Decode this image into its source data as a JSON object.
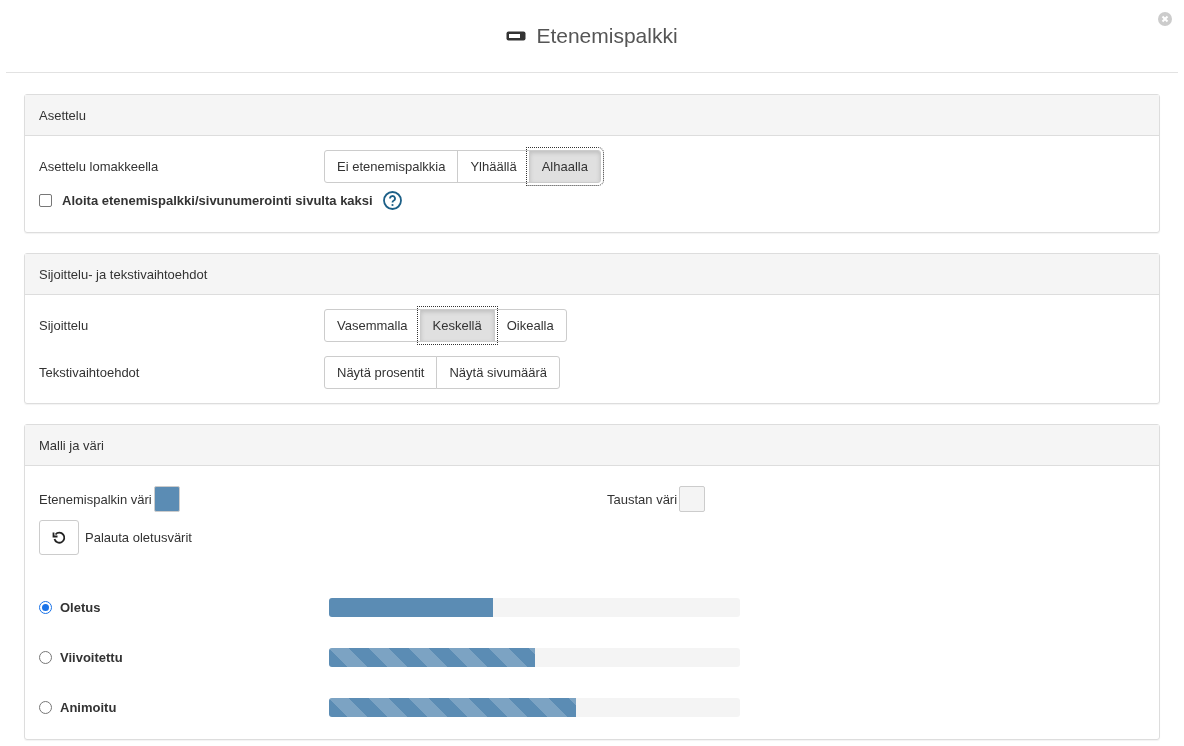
{
  "dialog": {
    "title": "Etenemispalkki"
  },
  "sections": [
    {
      "title": "Asettelu",
      "rows": [
        {
          "label": "Asettelu lomakkeella",
          "options": [
            {
              "label": "Ei etenemispalkkia",
              "selected": false
            },
            {
              "label": "Ylhäällä",
              "selected": false
            },
            {
              "label": "Alhaalla",
              "selected": true
            }
          ]
        }
      ],
      "checkbox": {
        "label": "Aloita etenemispalkki/sivunumerointi sivulta kaksi",
        "checked": false
      }
    },
    {
      "title": "Sijoittelu- ja tekstivaihtoehdot",
      "rows": [
        {
          "label": "Sijoittelu",
          "options": [
            {
              "label": "Vasemmalla",
              "selected": false
            },
            {
              "label": "Keskellä",
              "selected": true
            },
            {
              "label": "Oikealla",
              "selected": false
            }
          ]
        },
        {
          "label": "Tekstivaihtoehdot",
          "options": [
            {
              "label": "Näytä prosentit",
              "selected": false
            },
            {
              "label": "Näytä sivumäärä",
              "selected": false
            }
          ]
        }
      ]
    },
    {
      "title": "Malli ja väri",
      "colors": [
        {
          "label": "Etenemispalkin väri",
          "color": "#5b8cb4"
        },
        {
          "label": "Taustan väri",
          "color": "#f4f4f4"
        }
      ],
      "reset": "Palauta oletusvärit",
      "styles": [
        {
          "label": "Oletus",
          "kind": "solid",
          "selected": true,
          "level": 0.4
        },
        {
          "label": "Viivoitettu",
          "kind": "striped",
          "selected": false,
          "level": 0.5
        },
        {
          "label": "Animoitu",
          "kind": "striped",
          "selected": false,
          "level": 0.6
        }
      ]
    }
  ]
}
